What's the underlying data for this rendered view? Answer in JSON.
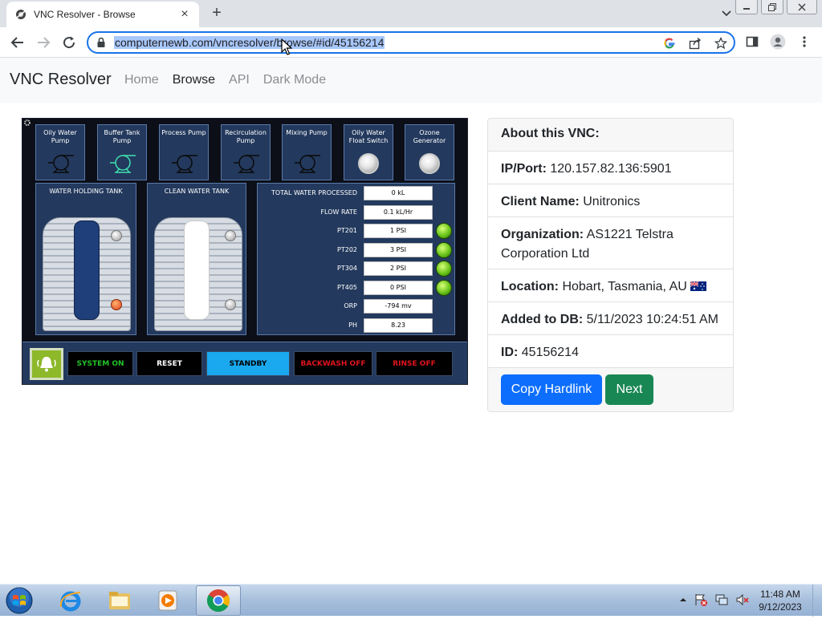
{
  "browser": {
    "tab_title": "VNC Resolver - Browse",
    "tab_close": "×",
    "new_tab": "+",
    "url": "computernewb.com/vncresolver/browse/#id/45156214"
  },
  "site": {
    "brand": "VNC Resolver",
    "nav": {
      "home": "Home",
      "browse": "Browse",
      "api": "API",
      "dark_mode": "Dark Mode"
    }
  },
  "hmi": {
    "pumps": [
      {
        "label": "Oily Water Pump",
        "kind": "pump",
        "color": "#0a0a0a"
      },
      {
        "label": "Buffer Tank Pump",
        "kind": "pump",
        "color": "#3fe0b0"
      },
      {
        "label": "Process Pump",
        "kind": "pump",
        "color": "#0a0a0a"
      },
      {
        "label": "Recirculation Pump",
        "kind": "pump",
        "color": "#0a0a0a"
      },
      {
        "label": "Mixing Pump",
        "kind": "pump",
        "color": "#0a0a0a"
      },
      {
        "label": "Oily Water Float Switch",
        "kind": "lamp"
      },
      {
        "label": "Ozone Generator",
        "kind": "lamp"
      }
    ],
    "tanks": {
      "holding": "WATER HOLDING TANK",
      "clean": "CLEAN WATER TANK"
    },
    "readings": [
      {
        "label": "TOTAL WATER PROCESSED",
        "value": "0 kL",
        "lamp": false
      },
      {
        "label": "FLOW RATE",
        "value": "0.1 kL/Hr",
        "lamp": false
      },
      {
        "label": "PT201",
        "value": "1 PSI",
        "lamp": true
      },
      {
        "label": "PT202",
        "value": "3 PSI",
        "lamp": true
      },
      {
        "label": "PT304",
        "value": "2 PSI",
        "lamp": true
      },
      {
        "label": "PT405",
        "value": "0 PSI",
        "lamp": true
      },
      {
        "label": "ORP",
        "value": "-794 mv",
        "lamp": false
      },
      {
        "label": "PH",
        "value": "8.23",
        "lamp": false
      }
    ],
    "controls": {
      "system_on": "SYSTEM ON",
      "reset": "RESET",
      "standby": "STANDBY",
      "backwash": "BACKWASH OFF",
      "rinse": "RINSE OFF"
    },
    "colors": {
      "panel": "#23395d",
      "system_on_text": "#22c32a",
      "standby_bg": "#1aa8ef",
      "off_text": "#e0141e"
    }
  },
  "about": {
    "header": "About this VNC:",
    "ip_label": "IP/Port:",
    "ip_value": "120.157.82.136:5901",
    "client_label": "Client Name:",
    "client_value": "Unitronics",
    "org_label": "Organization:",
    "org_value": "AS1221 Telstra Corporation Ltd",
    "location_label": "Location:",
    "location_value": "Hobart, Tasmania, AU",
    "added_label": "Added to DB:",
    "added_value": "5/11/2023 10:24:51 AM",
    "id_label": "ID:",
    "id_value": "45156214",
    "copy_button": "Copy Hardlink",
    "next_button": "Next"
  },
  "taskbar": {
    "time": "11:48 AM",
    "date": "9/12/2023"
  }
}
